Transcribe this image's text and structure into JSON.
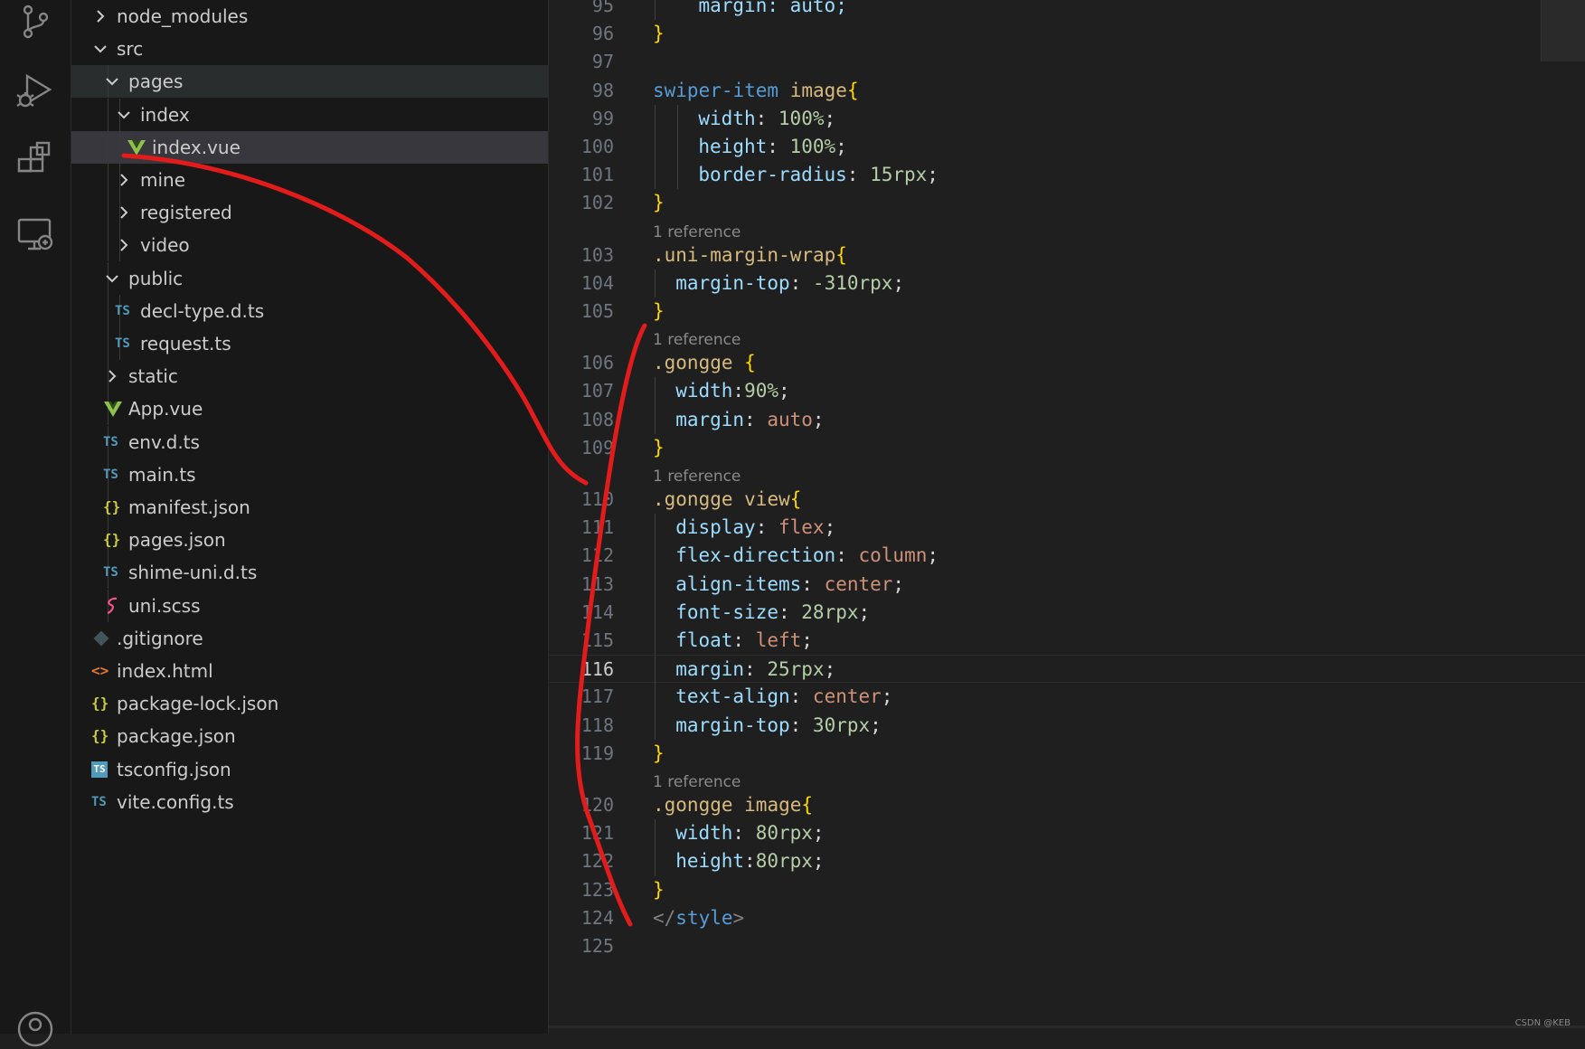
{
  "activity_bar": {
    "icons": [
      "source-control-icon",
      "run-debug-icon",
      "extensions-icon",
      "remote-explorer-icon",
      "account-icon"
    ]
  },
  "explorer": {
    "items": [
      {
        "name": "node_modules",
        "type": "folder",
        "expanded": false,
        "depth": 0
      },
      {
        "name": "src",
        "type": "folder",
        "expanded": true,
        "depth": 0
      },
      {
        "name": "pages",
        "type": "folder",
        "expanded": true,
        "depth": 1
      },
      {
        "name": "index",
        "type": "folder",
        "expanded": true,
        "depth": 2
      },
      {
        "name": "index.vue",
        "type": "vue",
        "depth": 3,
        "selected": true
      },
      {
        "name": "mine",
        "type": "folder",
        "expanded": false,
        "depth": 2
      },
      {
        "name": "registered",
        "type": "folder",
        "expanded": false,
        "depth": 2
      },
      {
        "name": "video",
        "type": "folder",
        "expanded": false,
        "depth": 2
      },
      {
        "name": "public",
        "type": "folder",
        "expanded": true,
        "depth": 1
      },
      {
        "name": "decl-type.d.ts",
        "type": "ts",
        "depth": 2
      },
      {
        "name": "request.ts",
        "type": "ts",
        "depth": 2
      },
      {
        "name": "static",
        "type": "folder",
        "expanded": false,
        "depth": 1
      },
      {
        "name": "App.vue",
        "type": "vue",
        "depth": 1
      },
      {
        "name": "env.d.ts",
        "type": "ts",
        "depth": 1
      },
      {
        "name": "main.ts",
        "type": "ts",
        "depth": 1
      },
      {
        "name": "manifest.json",
        "type": "json",
        "depth": 1
      },
      {
        "name": "pages.json",
        "type": "json",
        "depth": 1
      },
      {
        "name": "shime-uni.d.ts",
        "type": "ts",
        "depth": 1
      },
      {
        "name": "uni.scss",
        "type": "scss",
        "depth": 1
      },
      {
        "name": ".gitignore",
        "type": "git",
        "depth": 0
      },
      {
        "name": "index.html",
        "type": "html",
        "depth": 0
      },
      {
        "name": "package-lock.json",
        "type": "json",
        "depth": 0
      },
      {
        "name": "package.json",
        "type": "json",
        "depth": 0
      },
      {
        "name": "tsconfig.json",
        "type": "tsconfig",
        "depth": 0
      },
      {
        "name": "vite.config.ts",
        "type": "ts",
        "depth": 0
      }
    ],
    "icon_glyphs": {
      "ts": "TS",
      "json": "{}",
      "html": "<>",
      "tsconfig": "TS"
    }
  },
  "editor": {
    "current_line": "116",
    "codelens_text": "1 reference",
    "lines": [
      {
        "n": "95",
        "tokens": [
          {
            "t": "  margin: auto;",
            "c": "prop"
          }
        ],
        "indent": 1
      },
      {
        "n": "96",
        "tokens": [
          {
            "t": "}",
            "c": "brace"
          }
        ]
      },
      {
        "n": "97",
        "tokens": []
      },
      {
        "n": "98",
        "tokens": [
          {
            "t": "swiper-item",
            "c": "tag"
          },
          {
            "t": " image",
            "c": "sel"
          },
          {
            "t": "{",
            "c": "brace"
          }
        ]
      },
      {
        "n": "99",
        "tokens": [
          {
            "t": "width",
            "c": "prop"
          },
          {
            "t": ": ",
            "c": "punc"
          },
          {
            "t": "100%",
            "c": "num"
          },
          {
            "t": ";",
            "c": "punc"
          }
        ],
        "indent": 2
      },
      {
        "n": "100",
        "tokens": [
          {
            "t": "height",
            "c": "prop"
          },
          {
            "t": ": ",
            "c": "punc"
          },
          {
            "t": "100%",
            "c": "num"
          },
          {
            "t": ";",
            "c": "punc"
          }
        ],
        "indent": 2
      },
      {
        "n": "101",
        "tokens": [
          {
            "t": "border-radius",
            "c": "prop"
          },
          {
            "t": ": ",
            "c": "punc"
          },
          {
            "t": "15rpx",
            "c": "num"
          },
          {
            "t": ";",
            "c": "punc"
          }
        ],
        "indent": 2
      },
      {
        "n": "102",
        "tokens": [
          {
            "t": "}",
            "c": "brace"
          }
        ]
      },
      {
        "n": "103",
        "codelens": true,
        "tokens": [
          {
            "t": ".uni-margin-wrap",
            "c": "sel"
          },
          {
            "t": "{",
            "c": "brace"
          }
        ]
      },
      {
        "n": "104",
        "tokens": [
          {
            "t": "margin-top",
            "c": "prop"
          },
          {
            "t": ": ",
            "c": "punc"
          },
          {
            "t": "-310rpx",
            "c": "num"
          },
          {
            "t": ";",
            "c": "punc"
          }
        ],
        "indent": 1
      },
      {
        "n": "105",
        "tokens": [
          {
            "t": "}",
            "c": "brace"
          }
        ]
      },
      {
        "n": "106",
        "codelens": true,
        "tokens": [
          {
            "t": ".gongge",
            "c": "sel"
          },
          {
            "t": " ",
            "c": "punc"
          },
          {
            "t": "{",
            "c": "brace"
          }
        ]
      },
      {
        "n": "107",
        "tokens": [
          {
            "t": "width",
            "c": "prop"
          },
          {
            "t": ":",
            "c": "punc"
          },
          {
            "t": "90%",
            "c": "num"
          },
          {
            "t": ";",
            "c": "punc"
          }
        ],
        "indent": 1
      },
      {
        "n": "108",
        "tokens": [
          {
            "t": "margin",
            "c": "prop"
          },
          {
            "t": ": ",
            "c": "punc"
          },
          {
            "t": "auto",
            "c": "val"
          },
          {
            "t": ";",
            "c": "punc"
          }
        ],
        "indent": 1
      },
      {
        "n": "109",
        "tokens": [
          {
            "t": "}",
            "c": "brace"
          }
        ]
      },
      {
        "n": "110",
        "codelens": true,
        "tokens": [
          {
            "t": ".gongge",
            "c": "sel"
          },
          {
            "t": " view",
            "c": "sel"
          },
          {
            "t": "{",
            "c": "brace"
          }
        ]
      },
      {
        "n": "111",
        "tokens": [
          {
            "t": "display",
            "c": "prop"
          },
          {
            "t": ": ",
            "c": "punc"
          },
          {
            "t": "flex",
            "c": "val"
          },
          {
            "t": ";",
            "c": "punc"
          }
        ],
        "indent": 1
      },
      {
        "n": "112",
        "tokens": [
          {
            "t": "flex-direction",
            "c": "prop"
          },
          {
            "t": ": ",
            "c": "punc"
          },
          {
            "t": "column",
            "c": "val"
          },
          {
            "t": ";",
            "c": "punc"
          }
        ],
        "indent": 1
      },
      {
        "n": "113",
        "tokens": [
          {
            "t": "align-items",
            "c": "prop"
          },
          {
            "t": ": ",
            "c": "punc"
          },
          {
            "t": "center",
            "c": "val"
          },
          {
            "t": ";",
            "c": "punc"
          }
        ],
        "indent": 1
      },
      {
        "n": "114",
        "tokens": [
          {
            "t": "font-size",
            "c": "prop"
          },
          {
            "t": ": ",
            "c": "punc"
          },
          {
            "t": "28rpx",
            "c": "num"
          },
          {
            "t": ";",
            "c": "punc"
          }
        ],
        "indent": 1
      },
      {
        "n": "115",
        "tokens": [
          {
            "t": "float",
            "c": "prop"
          },
          {
            "t": ": ",
            "c": "punc"
          },
          {
            "t": "left",
            "c": "val"
          },
          {
            "t": ";",
            "c": "punc"
          }
        ],
        "indent": 1
      },
      {
        "n": "116",
        "tokens": [
          {
            "t": "margin",
            "c": "prop"
          },
          {
            "t": ": ",
            "c": "punc"
          },
          {
            "t": "25rpx",
            "c": "num"
          },
          {
            "t": ";",
            "c": "punc"
          }
        ],
        "indent": 1
      },
      {
        "n": "117",
        "tokens": [
          {
            "t": "text-align",
            "c": "prop"
          },
          {
            "t": ": ",
            "c": "punc"
          },
          {
            "t": "center",
            "c": "val"
          },
          {
            "t": ";",
            "c": "punc"
          }
        ],
        "indent": 1
      },
      {
        "n": "118",
        "tokens": [
          {
            "t": "margin-top",
            "c": "prop"
          },
          {
            "t": ": ",
            "c": "punc"
          },
          {
            "t": "30rpx",
            "c": "num"
          },
          {
            "t": ";",
            "c": "punc"
          }
        ],
        "indent": 1
      },
      {
        "n": "119",
        "tokens": [
          {
            "t": "}",
            "c": "brace"
          }
        ]
      },
      {
        "n": "120",
        "codelens": true,
        "tokens": [
          {
            "t": ".gongge",
            "c": "sel"
          },
          {
            "t": " image",
            "c": "sel"
          },
          {
            "t": "{",
            "c": "brace"
          }
        ]
      },
      {
        "n": "121",
        "tokens": [
          {
            "t": "width",
            "c": "prop"
          },
          {
            "t": ": ",
            "c": "punc"
          },
          {
            "t": "80rpx",
            "c": "num"
          },
          {
            "t": ";",
            "c": "punc"
          }
        ],
        "indent": 1
      },
      {
        "n": "122",
        "tokens": [
          {
            "t": "height",
            "c": "prop"
          },
          {
            "t": ":",
            "c": "punc"
          },
          {
            "t": "80rpx",
            "c": "num"
          },
          {
            "t": ";",
            "c": "punc"
          }
        ],
        "indent": 1
      },
      {
        "n": "123",
        "tokens": [
          {
            "t": "}",
            "c": "brace"
          }
        ]
      },
      {
        "n": "124",
        "tokens": [
          {
            "t": "</",
            "c": "angle"
          },
          {
            "t": "style",
            "c": "tag"
          },
          {
            "t": ">",
            "c": "angle"
          }
        ]
      },
      {
        "n": "125",
        "tokens": []
      }
    ]
  },
  "colors": {
    "tag": "#569cd6",
    "sel": "#d7ba7d",
    "prop": "#9cdcfe",
    "num": "#b5cea8",
    "val": "#ce9178",
    "brace": "#ffd700",
    "punc": "#d4d4d4",
    "angle": "#808080",
    "ts_icon": "#519aba",
    "json_icon": "#cbcb41",
    "html_icon": "#e37933",
    "vue_icon": "#8dc149",
    "scss_icon": "#f55385",
    "git_icon": "#41535b",
    "annotation": "#e21b1b"
  },
  "watermark": "CSDN @KEB"
}
